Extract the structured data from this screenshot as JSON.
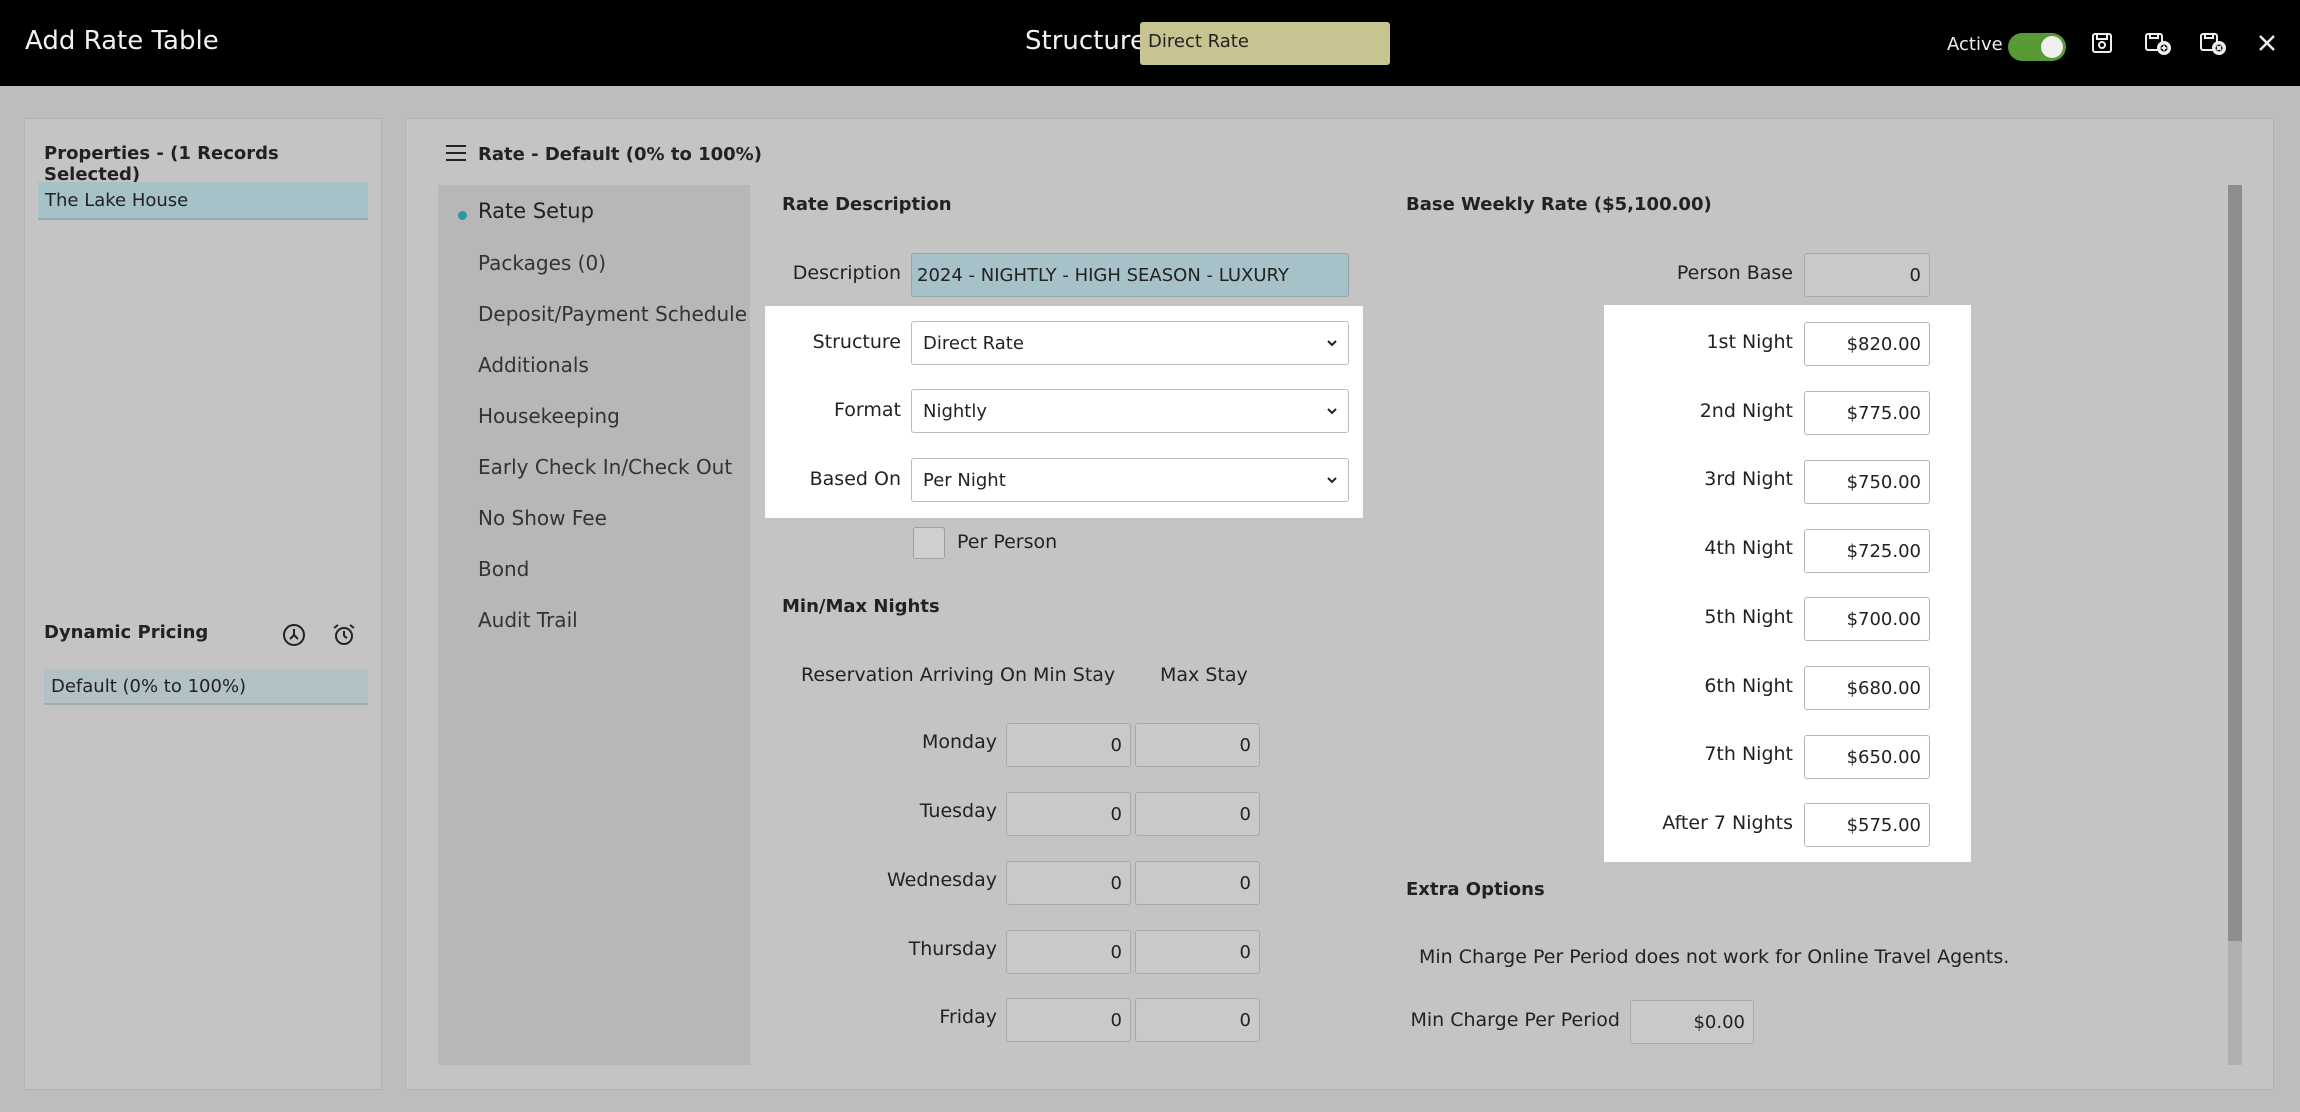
{
  "topbar": {
    "title": "Add Rate Table",
    "structure_label": "Structure",
    "structure_value": "Direct Rate",
    "active_label": "Active",
    "active_on": true
  },
  "properties": {
    "heading": "Properties - (1 Records Selected)",
    "selected": "The Lake House"
  },
  "dynamic_pricing": {
    "heading": "Dynamic Pricing",
    "item": "Default (0% to 100%)"
  },
  "main": {
    "header": "Rate - Default (0% to 100%)"
  },
  "nav": {
    "items": [
      "Rate Setup",
      "Packages (0)",
      "Deposit/Payment Schedule",
      "Additionals",
      "Housekeeping",
      "Early Check In/Check Out",
      "No Show Fee",
      "Bond",
      "Audit Trail"
    ]
  },
  "rate_description": {
    "title": "Rate Description",
    "description_label": "Description",
    "description_value": "2024 - NIGHTLY - HIGH SEASON - LUXURY",
    "structure_label": "Structure",
    "structure_value": "Direct Rate",
    "format_label": "Format",
    "format_value": "Nightly",
    "based_on_label": "Based On",
    "based_on_value": "Per Night",
    "per_person_label": "Per Person"
  },
  "min_max": {
    "title": "Min/Max Nights",
    "col_arriving": "Reservation Arriving On",
    "col_min": "Min Stay",
    "col_max": "Max Stay",
    "rows": [
      {
        "day": "Monday",
        "min": "0",
        "max": "0"
      },
      {
        "day": "Tuesday",
        "min": "0",
        "max": "0"
      },
      {
        "day": "Wednesday",
        "min": "0",
        "max": "0"
      },
      {
        "day": "Thursday",
        "min": "0",
        "max": "0"
      },
      {
        "day": "Friday",
        "min": "0",
        "max": "0"
      }
    ]
  },
  "base_weekly": {
    "title": "Base Weekly Rate ($5,100.00)",
    "person_base_label": "Person Base",
    "person_base_value": "0",
    "nights": [
      {
        "label": "1st Night",
        "value": "$820.00"
      },
      {
        "label": "2nd Night",
        "value": "$775.00"
      },
      {
        "label": "3rd Night",
        "value": "$750.00"
      },
      {
        "label": "4th Night",
        "value": "$725.00"
      },
      {
        "label": "5th Night",
        "value": "$700.00"
      },
      {
        "label": "6th Night",
        "value": "$680.00"
      },
      {
        "label": "7th Night",
        "value": "$650.00"
      },
      {
        "label": "After 7 Nights",
        "value": "$575.00"
      }
    ]
  },
  "extra_options": {
    "title": "Extra Options",
    "note": "Min Charge Per Period does not work for Online Travel Agents.",
    "min_charge_label": "Min Charge Per Period",
    "min_charge_value": "$0.00"
  },
  "colors": {
    "topbar": "#000000",
    "accent_toggle": "#5a9a36",
    "selected_row": "#a6c1c8",
    "structure_highlight": "#c7c491"
  }
}
